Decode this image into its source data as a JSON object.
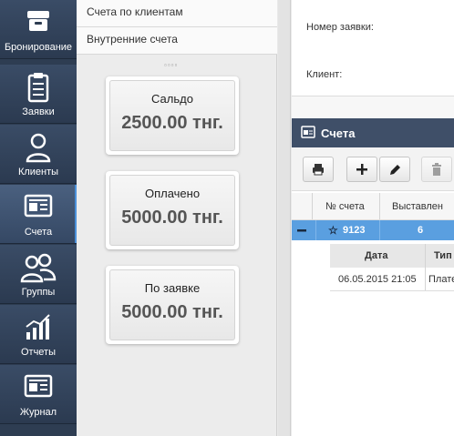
{
  "nav": {
    "items": [
      {
        "label": "Бронирование",
        "icon": "archive-box-icon"
      },
      {
        "label": "Заявки",
        "icon": "clipboard-icon"
      },
      {
        "label": "Клиенты",
        "icon": "user-icon"
      },
      {
        "label": "Счета",
        "icon": "newspaper-icon"
      },
      {
        "label": "Группы",
        "icon": "users-group-icon"
      },
      {
        "label": "Отчеты",
        "icon": "chart-icon"
      },
      {
        "label": "Журнал",
        "icon": "journal-icon"
      }
    ],
    "active": "Счета"
  },
  "submenu": {
    "items": [
      "Счета по клиентам",
      "Внутренние счета"
    ]
  },
  "summary_cards": [
    {
      "title": "Сальдо",
      "value": "2500.00 тнг."
    },
    {
      "title": "Оплачено",
      "value": "5000.00 тнг."
    },
    {
      "title": "По заявке",
      "value": "5000.00 тнг."
    }
  ],
  "form": {
    "order_number_label": "Номер заявки:",
    "client_label": "Клиент:"
  },
  "accounts_panel": {
    "title": "Счета",
    "columns": [
      "№ счета",
      "Выставлен"
    ],
    "selected_row": {
      "number": "9123",
      "issued": "6"
    },
    "sub_columns": [
      "Дата",
      "Тип"
    ],
    "sub_rows": [
      {
        "date": "06.05.2015 21:05",
        "type": "Плате"
      }
    ]
  },
  "colors": {
    "nav_bg": "#2e3d52",
    "panel_header": "#3f4f68",
    "selected_row": "#5a9fe0"
  }
}
